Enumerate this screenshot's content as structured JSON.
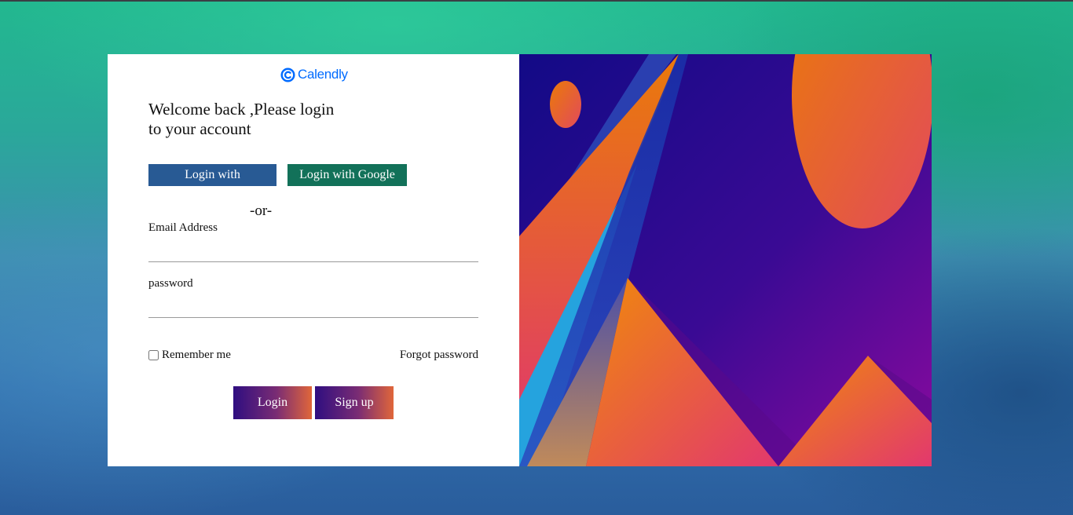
{
  "brand": {
    "name": "Calendly",
    "color": "#006bff"
  },
  "login": {
    "welcome_line1": "Welcome back ,Please login",
    "welcome_line2": "to your account",
    "facebook_label": "Login with facebook",
    "google_label": "Login with Google",
    "or_text": "-or-",
    "email_label": "Email Address",
    "email_value": "",
    "password_label": "password",
    "password_value": "",
    "remember_label": "Remember me",
    "remember_checked": false,
    "forgot_label": "Forgot password",
    "login_label": "Login",
    "signup_label": "Sign up"
  },
  "colors": {
    "facebook_button": "#285a94",
    "google_button": "#127159",
    "action_gradient": [
      "#2f0e80",
      "#7a2c74",
      "#e0663a"
    ],
    "illustration": [
      "#14088a",
      "#7b0a9c",
      "#e8780c",
      "#e43d6b",
      "#28a8e0"
    ]
  },
  "illustration": {
    "description_icon": "geometric-mountains-illustration"
  }
}
